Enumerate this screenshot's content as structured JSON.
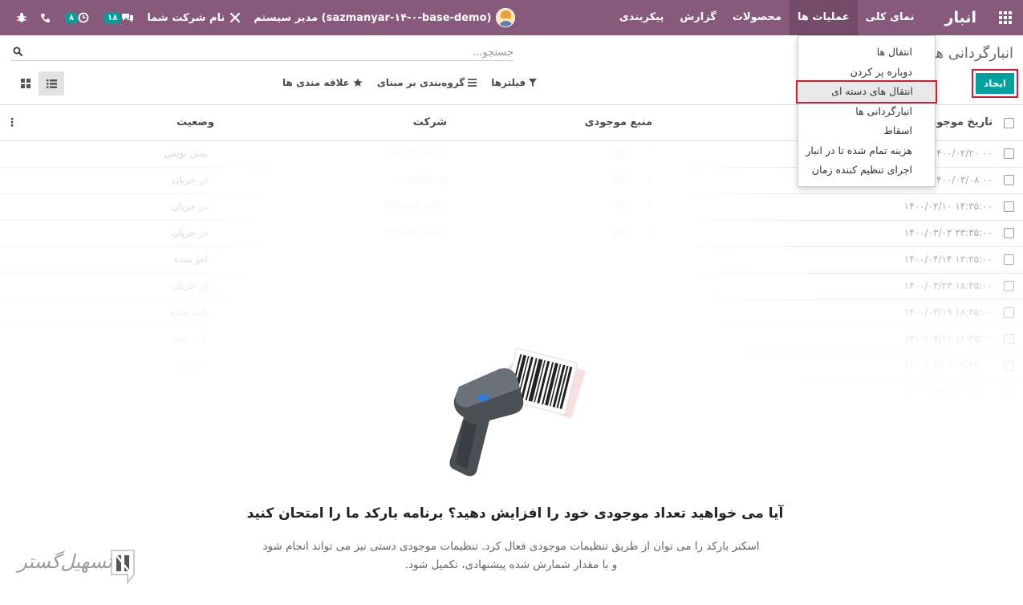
{
  "navbar": {
    "brand": "انبار",
    "menu": [
      {
        "label": "نمای کلی",
        "active": false
      },
      {
        "label": "عملیات ها",
        "active": true
      },
      {
        "label": "محصولات",
        "active": false
      },
      {
        "label": "گزارش",
        "active": false
      },
      {
        "label": "پیکربندی",
        "active": false
      }
    ],
    "user_label": "(sazmanyar-۱۴-۰-base-demo) مدیر سیستم",
    "company_label": "نام شرکت شما",
    "messages_count": "۱۸",
    "activities_count": "۸",
    "accent_color": "#875a7b"
  },
  "control_panel": {
    "breadcrumb": "انبارگردانی ها",
    "search_placeholder": "جستجو...",
    "create_label": "ایجاد",
    "filters_label": "فیلترها",
    "groupby_label": "گروه‌بندی بر مبنای",
    "favorites_label": "علاقه مندی ها"
  },
  "dropdown": {
    "items": [
      {
        "label": "انتقال ها",
        "highlighted": false
      },
      {
        "label": "دوباره پر کردن",
        "highlighted": false
      },
      {
        "label": "انتقال های دسته ای",
        "highlighted": true
      },
      {
        "label": "انبارگردانی ها",
        "highlighted": false
      },
      {
        "label": "اسقاط",
        "highlighted": false
      },
      {
        "label": "هزینه تمام شده تا در انبار",
        "highlighted": false
      },
      {
        "label": "اجرای تنظیم کننده زمان",
        "highlighted": false
      }
    ]
  },
  "table": {
    "columns": {
      "date": "تاریخ موجودی",
      "source": "منبع موجودی",
      "company": "شرکت",
      "status": "وضعیت"
    },
    "rows": [
      {
        "date": "۰۰ ۱۴۰۰/۰۲/۲۰",
        "ref": "REF۰۰۰۱",
        "company": "Viverra nam",
        "status": "پیش نویس"
      },
      {
        "date": "۰۰ ۱۴۰۰/۰۳/۰۸",
        "ref": "REF۰۰۰۲",
        "company": "Laoreet id",
        "status": "در جریان"
      },
      {
        "date": "۱۴:۳۵:۰۰ ۱۴۰۰/۰۲/۱۰",
        "ref": "REF۰۰۰۳",
        "company": "Integer vitae",
        "status": "در جریان"
      },
      {
        "date": "۲۳:۳۵:۰۰ ۱۴۰۰/۰۳/۰۲",
        "ref": "REF۰۰۰۴",
        "company": "Integer vitae",
        "status": "در جریان"
      },
      {
        "date": "۱۳:۳۵:۰۰ ۱۴۰۰/۰۴/۱۴",
        "ref": "",
        "company": "",
        "status": "لغو شده"
      },
      {
        "date": "۱۸:۳۵:۰۰ ۱۴۰۰/۰۳/۲۳",
        "ref": "",
        "company": "",
        "status": "در جریان"
      },
      {
        "date": "۱۸:۳۵:۰۰ ۱۴۰۰/۰۳/۱۹",
        "ref": "",
        "company": "",
        "status": "تایید شده"
      },
      {
        "date": "۱۶:۳۵:۰۰ ۱۴۰۰/۰۳/۱۱",
        "ref": "",
        "company": "",
        "status": "تایید شده"
      },
      {
        "date": "۰۹:۳۵:۰۰ ۱۴۰۰/۰۳/۰۹",
        "ref": "",
        "company": "",
        "status": "لغو شده"
      },
      {
        "date": "۱۷:۳۵:۰۰ ۱۴۰۰/۰۴/۲۸",
        "ref": "",
        "company": "",
        "status": "در جریان"
      }
    ]
  },
  "helper": {
    "title": "آیا می خواهید تعداد موجودی خود را افزایش دهید؟ برنامه بارکد ما را امتحان کنید",
    "text": "اسکنر بارکد را می توان از طریق تنظیمات موجودی فعال کرد. تنظیمات موجودی دستی نیز می تواند انجام شود و با مقدار شمارش شده پیشنهادی، تکمیل شود."
  },
  "watermark": {
    "text": "تسهیل‌گستر"
  }
}
